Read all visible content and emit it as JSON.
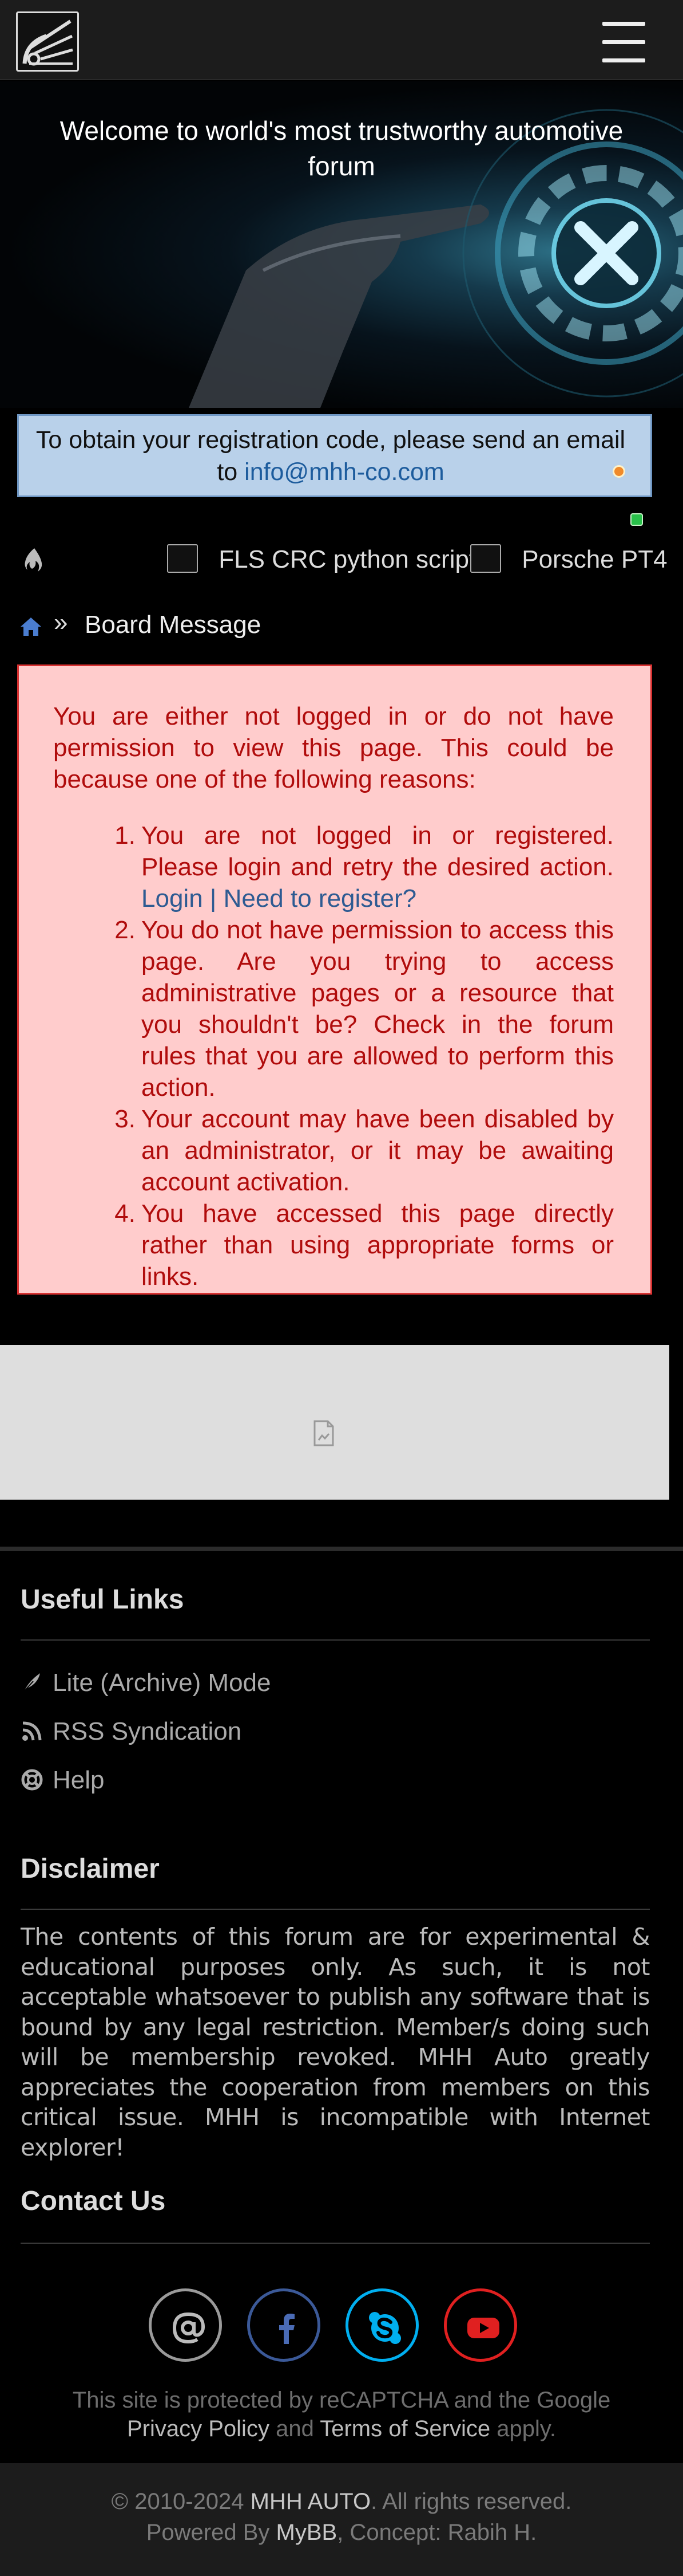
{
  "header": {
    "logo_icon": "mhh-auto-logo-icon",
    "menu_icon": "hamburger-menu-icon"
  },
  "hero": {
    "title": "Welcome to world's most trustworthy automotive forum"
  },
  "notice": {
    "text": "To obtain your registration code, please send an email to",
    "email": "info@mhh-co.com"
  },
  "ticker": {
    "icon": "fire-icon",
    "items": [
      {
        "label": "FLS CRC python script"
      },
      {
        "label": "Porsche PT4"
      }
    ]
  },
  "breadcrumb": {
    "home_icon": "home-icon",
    "separator": "»",
    "current": "Board Message"
  },
  "error": {
    "intro": "You are either not logged in or do not have permission to view this page. This could be because one of the following reasons:",
    "items": [
      {
        "num": "1.",
        "text": "You are not logged in or registered. Please login and retry the desired action.",
        "login": "Login",
        "divider": "|",
        "register": "Need to register?"
      },
      {
        "num": "2.",
        "text": "You do not have permission to access this page. Are you trying to access administrative pages or a resource that you shouldn't be? Check in the forum rules that you are allowed to perform this action."
      },
      {
        "num": "3.",
        "text": "Your account may have been disabled by an administrator, or it may be awaiting account activation."
      },
      {
        "num": "4.",
        "text": "You have accessed this page directly rather than using appropriate forms or links."
      }
    ],
    "colors": {
      "background": "#ffcccc",
      "border": "#d93131",
      "text": "#b00c0c"
    }
  },
  "footer": {
    "useful_links_title": "Useful Links",
    "links": [
      {
        "label": "Lite (Archive) Mode",
        "icon": "feather-icon"
      },
      {
        "label": "RSS Syndication",
        "icon": "rss-icon"
      },
      {
        "label": "Help",
        "icon": "lifebuoy-icon"
      }
    ],
    "disclaimer_title": "Disclaimer",
    "disclaimer_text": "The contents of this forum are for experimental & educational purposes only. As such, it is not acceptable whatsoever to publish any software that is bound by any legal restriction. Member/s doing such will be membership revoked. MHH Auto greatly appreciates the cooperation from members on this critical issue. MHH is incompatible with Internet explorer!",
    "contact_title": "Contact Us",
    "social": [
      {
        "icon": "email-at-icon",
        "color": "#9a9a9a"
      },
      {
        "icon": "facebook-icon",
        "color": "#3b5998"
      },
      {
        "icon": "skype-icon",
        "color": "#00aff0"
      },
      {
        "icon": "youtube-icon",
        "color": "#e02020"
      }
    ],
    "recaptcha": {
      "line1": "This site is protected by reCAPTCHA and the Google",
      "privacy": "Privacy Policy",
      "and": "and",
      "terms": "Terms of Service",
      "apply": "apply."
    },
    "copyright": {
      "prefix": "© 2010-2024",
      "brand": "MHH AUTO",
      "rights": ". All rights reserved.",
      "powered_prefix": "Powered By",
      "mybb": "MyBB",
      "concept": ", Concept: Rabih H."
    }
  }
}
